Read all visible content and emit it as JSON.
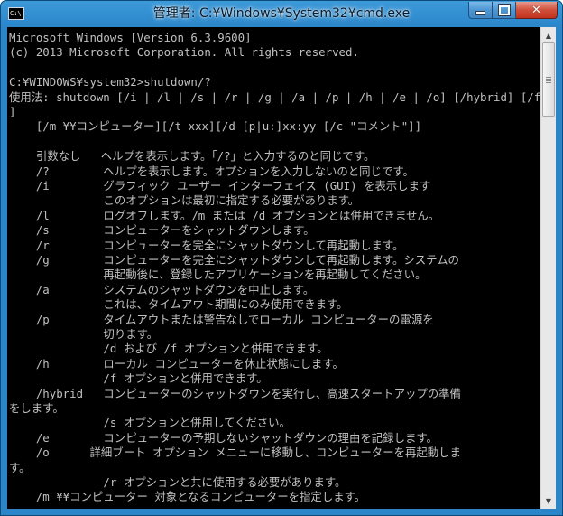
{
  "window": {
    "title": "管理者: C:¥Windows¥System32¥cmd.exe",
    "icon_label": "C:\\"
  },
  "controls": {
    "minimize_icon": "minimize-icon",
    "maximize_icon": "maximize-icon",
    "close_label": "✕"
  },
  "console": {
    "lines": [
      "Microsoft Windows [Version 6.3.9600]",
      "(c) 2013 Microsoft Corporation. All rights reserved.",
      "",
      "C:¥WINDOWS¥system32>shutdown/?",
      "使用法: shutdown [/i | /l | /s | /r | /g | /a | /p | /h | /e | /o] [/hybrid] [/f",
      "]",
      "    [/m ¥¥コンピューター][/t xxx][/d [p|u:]xx:yy [/c \"コメント\"]]",
      "",
      "    引数なし   ヘルプを表示します。「/?」と入力するのと同じです。",
      "    /?        ヘルプを表示します。オプションを入力しないのと同じです。",
      "    /i        グラフィック ユーザー インターフェイス (GUI) を表示します",
      "              このオプションは最初に指定する必要があります。",
      "    /l        ログオフします。/m または /d オプションとは併用できません。",
      "    /s        コンピューターをシャットダウンします。",
      "    /r        コンピューターを完全にシャットダウンして再起動します。",
      "    /g        コンピューターを完全にシャットダウンして再起動します。システムの",
      "              再起動後に、登録したアプリケーションを再起動してください。",
      "    /a        システムのシャットダウンを中止します。",
      "              これは、タイムアウト期間にのみ使用できます。",
      "    /p        タイムアウトまたは警告なしでローカル コンピューターの電源を",
      "              切ります。",
      "              /d および /f オプションと併用できます。",
      "    /h        ローカル コンピューターを休止状態にします。",
      "              /f オプションと併用できます。",
      "    /hybrid   コンピューターのシャットダウンを実行し、高速スタートアップの準備",
      "をします。",
      "              /s オプションと併用してください。",
      "    /e        コンピューターの予期しないシャットダウンの理由を記録します。",
      "    /o      詳細ブート オプション メニューに移動し、コンピューターを再起動しま",
      "す。",
      "              /r オプションと共に使用する必要があります。",
      "    /m ¥¥コンピューター 対象となるコンピューターを指定します。"
    ]
  },
  "scrollbar": {
    "up_icon": "scroll-up-arrow-icon",
    "down_icon": "scroll-down-arrow-icon"
  },
  "colors": {
    "console_background": "#000000",
    "console_text": "#c0c0c0",
    "titlebar": "#2a85c9"
  }
}
